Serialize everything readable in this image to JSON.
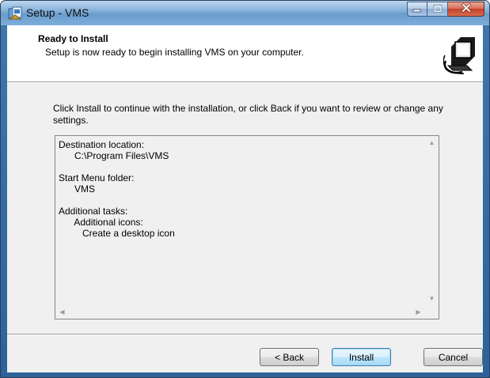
{
  "window": {
    "title": "Setup - VMS",
    "icon": "setup-icon"
  },
  "caption_buttons": {
    "minimize_icon": "minimize-icon",
    "maximize_icon": "maximize-icon",
    "close_icon": "close-icon"
  },
  "header": {
    "title": "Ready to Install",
    "subtitle": "Setup is now ready to begin installing VMS on your computer.",
    "image": "computer-install-icon"
  },
  "instruction": "Click Install to continue with the installation, or click Back if you want to review or change any settings.",
  "memo": {
    "lines": [
      "Destination location:",
      "      C:\\Program Files\\VMS",
      "",
      "Start Menu folder:",
      "      VMS",
      "",
      "Additional tasks:",
      "      Additional icons:",
      "         Create a desktop icon"
    ]
  },
  "buttons": {
    "back": "< Back",
    "install": "Install",
    "cancel": "Cancel"
  },
  "colors": {
    "title_bar": "#86b2db",
    "client_background": "#f0f0f0",
    "header_background": "#ffffff",
    "close_button": "#c2432a",
    "default_button_border": "#3c7fb1"
  }
}
